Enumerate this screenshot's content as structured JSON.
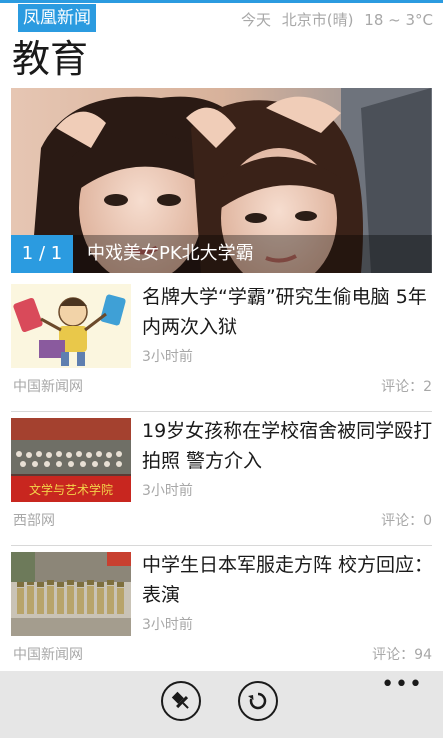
{
  "app": {
    "name": "凤凰新闻",
    "accent_color": "#2b9be0"
  },
  "status": {
    "day": "今天",
    "location_weather": "北京市(晴)",
    "temperature": "18 ~ 3°C"
  },
  "page": {
    "title": "教育"
  },
  "hero": {
    "counter": "1 / 1",
    "caption": "中戏美女PK北大学霸"
  },
  "news": [
    {
      "title": "名牌大学“学霸”研究生偷电脑 5年内两次入狱",
      "time": "3小时前",
      "source": "中国新闻网",
      "comments": "评论：2"
    },
    {
      "title": "19岁女孩称在学校宿舍被同学殴打拍照 警方介入",
      "time": "3小时前",
      "source": "西部网",
      "comments": "评论：0"
    },
    {
      "title": "中学生日本军服走方阵 校方回应：表演",
      "time": "3小时前",
      "source": "中国新闻网",
      "comments": "评论：94"
    }
  ],
  "thumb_banner_text": "文学与艺术学院",
  "app_bar": {
    "more_label": "•••",
    "buttons": [
      "pin-icon",
      "refresh-icon"
    ]
  }
}
